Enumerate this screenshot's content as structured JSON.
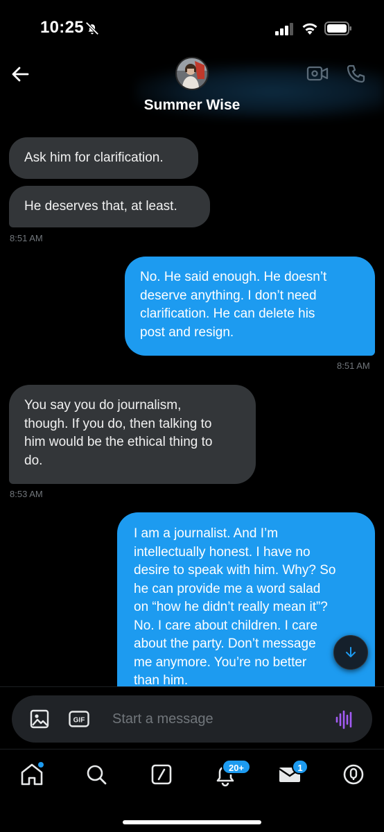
{
  "status_bar": {
    "time": "10:25"
  },
  "header": {
    "contact_name": "Summer Wise"
  },
  "messages": [
    {
      "direction": "received",
      "lines": [
        "Ask him for clarification."
      ]
    },
    {
      "direction": "received",
      "lines": [
        "He deserves that, at least."
      ],
      "timestamp": "8:51 AM"
    },
    {
      "direction": "sent",
      "lines": [
        "No.  He said enough.   He doesn’t",
        "deserve anything.   I don’t need",
        "clarification.  He can delete his",
        "post and resign."
      ],
      "timestamp": "8:51 AM"
    },
    {
      "direction": "received",
      "lines": [
        "You say you do journalism,",
        "though. If you do, then talking to",
        "him would be the ethical thing to",
        "do."
      ],
      "timestamp": "8:53 AM"
    },
    {
      "direction": "sent",
      "lines": [
        "I am a journalist.   And I’m",
        "intellectually honest.  I have no",
        "desire to speak with him. Why? So",
        "he can provide me a word salad",
        "on “how he didn’t really mean it”?",
        "No.  I care about children.  I care",
        "about the party.  Don’t message",
        "me anymore.  You’re no better",
        "than him."
      ]
    }
  ],
  "composer": {
    "placeholder": "Start a message",
    "gif_label": "GIF"
  },
  "tabs": {
    "notifications_badge": "20+",
    "messages_badge": "1"
  },
  "colors": {
    "accent": "#1d9bf0",
    "received_bubble": "#333639",
    "voice_icon": "#a35cf5"
  }
}
